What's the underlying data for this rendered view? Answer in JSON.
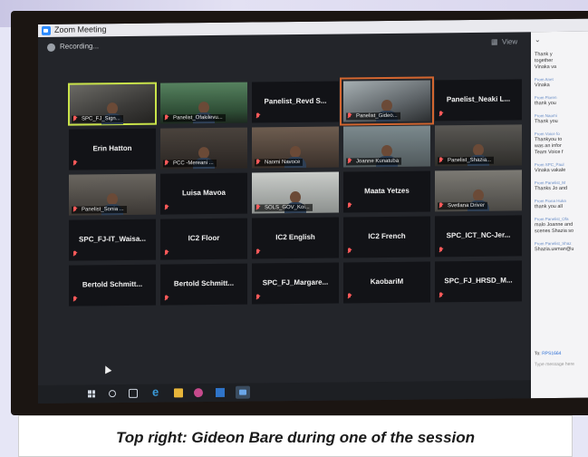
{
  "window": {
    "title": "Zoom Meeting"
  },
  "toolbar": {
    "recording_label": "Recording...",
    "view_label": "View"
  },
  "gallery": {
    "tiles": [
      {
        "name": "SPC_FJ_Sign...",
        "video": true,
        "speaking": true
      },
      {
        "name": "Panelist_Ofakilevu...",
        "video": true
      },
      {
        "name": "Panelist_Revd S...",
        "video": false
      },
      {
        "name": "Panelist_Gideo...",
        "video": true,
        "highlighted": true
      },
      {
        "name": "Panelist_Neaki L...",
        "video": false
      },
      {
        "name": "Erin Hatton",
        "video": false
      },
      {
        "name": "PCC -Mereani ...",
        "video": true
      },
      {
        "name": "Naomi Navoce",
        "video": true
      },
      {
        "name": "Joanne Kunatuba",
        "video": true
      },
      {
        "name": "Panelist_Shazia...",
        "video": true
      },
      {
        "name": "Panelist_Sonia ...",
        "video": true
      },
      {
        "name": "Luisa Mavoa",
        "video": false
      },
      {
        "name": "SOLS_GOV_Koi...",
        "video": true
      },
      {
        "name": "Maata Yetzes",
        "video": false
      },
      {
        "name": "Svetlana Driver",
        "video": true
      },
      {
        "name": "SPC_FJ-IT_Waisa...",
        "video": false
      },
      {
        "name": "IC2 Floor",
        "video": false
      },
      {
        "name": "IC2 English",
        "video": false
      },
      {
        "name": "IC2 French",
        "video": false
      },
      {
        "name": "SPC_ICT_NC-Jer...",
        "video": false
      },
      {
        "name": "Bertold Schmitt...",
        "video": false
      },
      {
        "name": "Bertold Schmitt...",
        "video": false
      },
      {
        "name": "SPC_FJ_Margare...",
        "video": false
      },
      {
        "name": "KaobariM",
        "video": false
      },
      {
        "name": "SPC_FJ_HRSD_M...",
        "video": false
      }
    ]
  },
  "chat": {
    "messages": [
      {
        "from": "",
        "text": "Thank y\ntogether\nVinaka va"
      },
      {
        "from": "From Anet",
        "text": "Vinaka"
      },
      {
        "from": "From Floren",
        "text": "thank you"
      },
      {
        "from": "From Naomi",
        "text": "Thank you"
      },
      {
        "from": "From Voice fo",
        "text": "Thankyou to\nwas an infor\nTeam Voice f"
      },
      {
        "from": "From SPC_Paul",
        "text": "Vinaka vakale"
      },
      {
        "from": "From Panelist_M",
        "text": "Thanks Jo and"
      },
      {
        "from": "From Fiona Huka",
        "text": "thank you all"
      },
      {
        "from": "From Panelist_Ofa",
        "text": "malo Joanne and\nscenes Shazia so"
      },
      {
        "from": "From Panelist_Shaz",
        "text": "Shazia.usman@u"
      }
    ],
    "to_label": "To:",
    "to_value": "RPS1664",
    "input_placeholder": "Type message here"
  },
  "caption": {
    "text": "Top right: Gideon Bare during one of the session"
  },
  "colors": {
    "speaking": "#c9e34a",
    "highlight": "#d2652f",
    "muted": "#ff5a5a",
    "zoom_blue": "#2d8cff"
  }
}
